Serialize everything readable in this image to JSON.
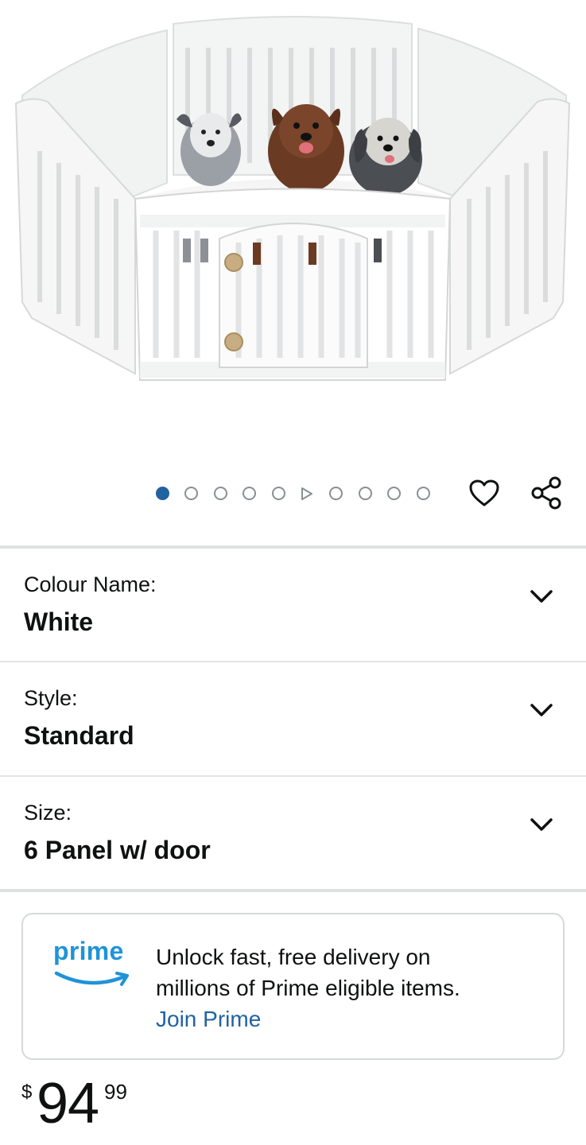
{
  "product": {
    "image_alt": "White plastic 6-panel pet playpen with three dogs inside"
  },
  "carousel": {
    "total_items": 10,
    "active_index": 0,
    "video_index": 5,
    "icons": {
      "wishlist": "heart-outline-icon",
      "share": "share-icon"
    }
  },
  "variations": [
    {
      "label": "Colour Name:",
      "value": "White",
      "icon": "chevron-down-icon"
    },
    {
      "label": "Style:",
      "value": "Standard",
      "icon": "chevron-down-icon"
    },
    {
      "label": "Size:",
      "value": "6 Panel w/ door",
      "icon": "chevron-down-icon"
    }
  ],
  "prime": {
    "logo_text": "prime",
    "line1": "Unlock fast, free delivery on",
    "line2": "millions of Prime eligible items.",
    "link": "Join Prime",
    "colors": {
      "logo": "#1f93d8",
      "link": "#2162a1"
    }
  },
  "price": {
    "symbol": "$",
    "whole": "94",
    "fraction": "99"
  },
  "colors": {
    "active_dot": "#2162a1",
    "text": "#0f1111",
    "divider": "#dfe1e1"
  }
}
